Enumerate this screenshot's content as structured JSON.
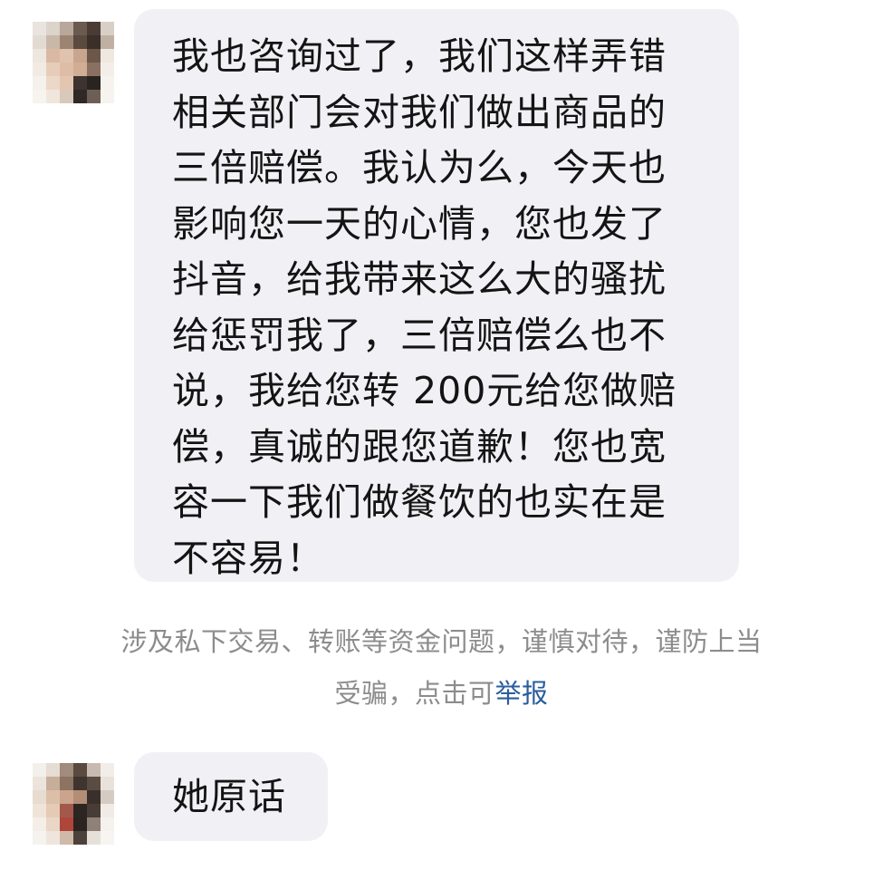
{
  "messages": [
    {
      "sender": "other",
      "text": "我也咨询过了，我们这样弄错\n相关部门会对我们做出商品的\n三倍赔偿。我认为么，今天也\n影响您一天的心情，您也发了\n抖音，给我带来这么大的骚扰\n给惩罚我了，三倍赔偿么也不\n说，我给您转 200元给您做赔\n偿，真诚的跟您道歉！您也宽\n容一下我们做餐饮的也实在是\n不容易！"
    },
    {
      "sender": "other",
      "text": "她原话"
    }
  ],
  "notice": {
    "line1": "涉及私下交易、转账等资金问题，谨慎对待，谨防上当",
    "line2_prefix": "受骗，点击可",
    "report_link": "举报"
  },
  "colors": {
    "bubble_bg": "#f1f1f5",
    "notice_text": "#8c8c8c",
    "link": "#2b5d9e"
  }
}
